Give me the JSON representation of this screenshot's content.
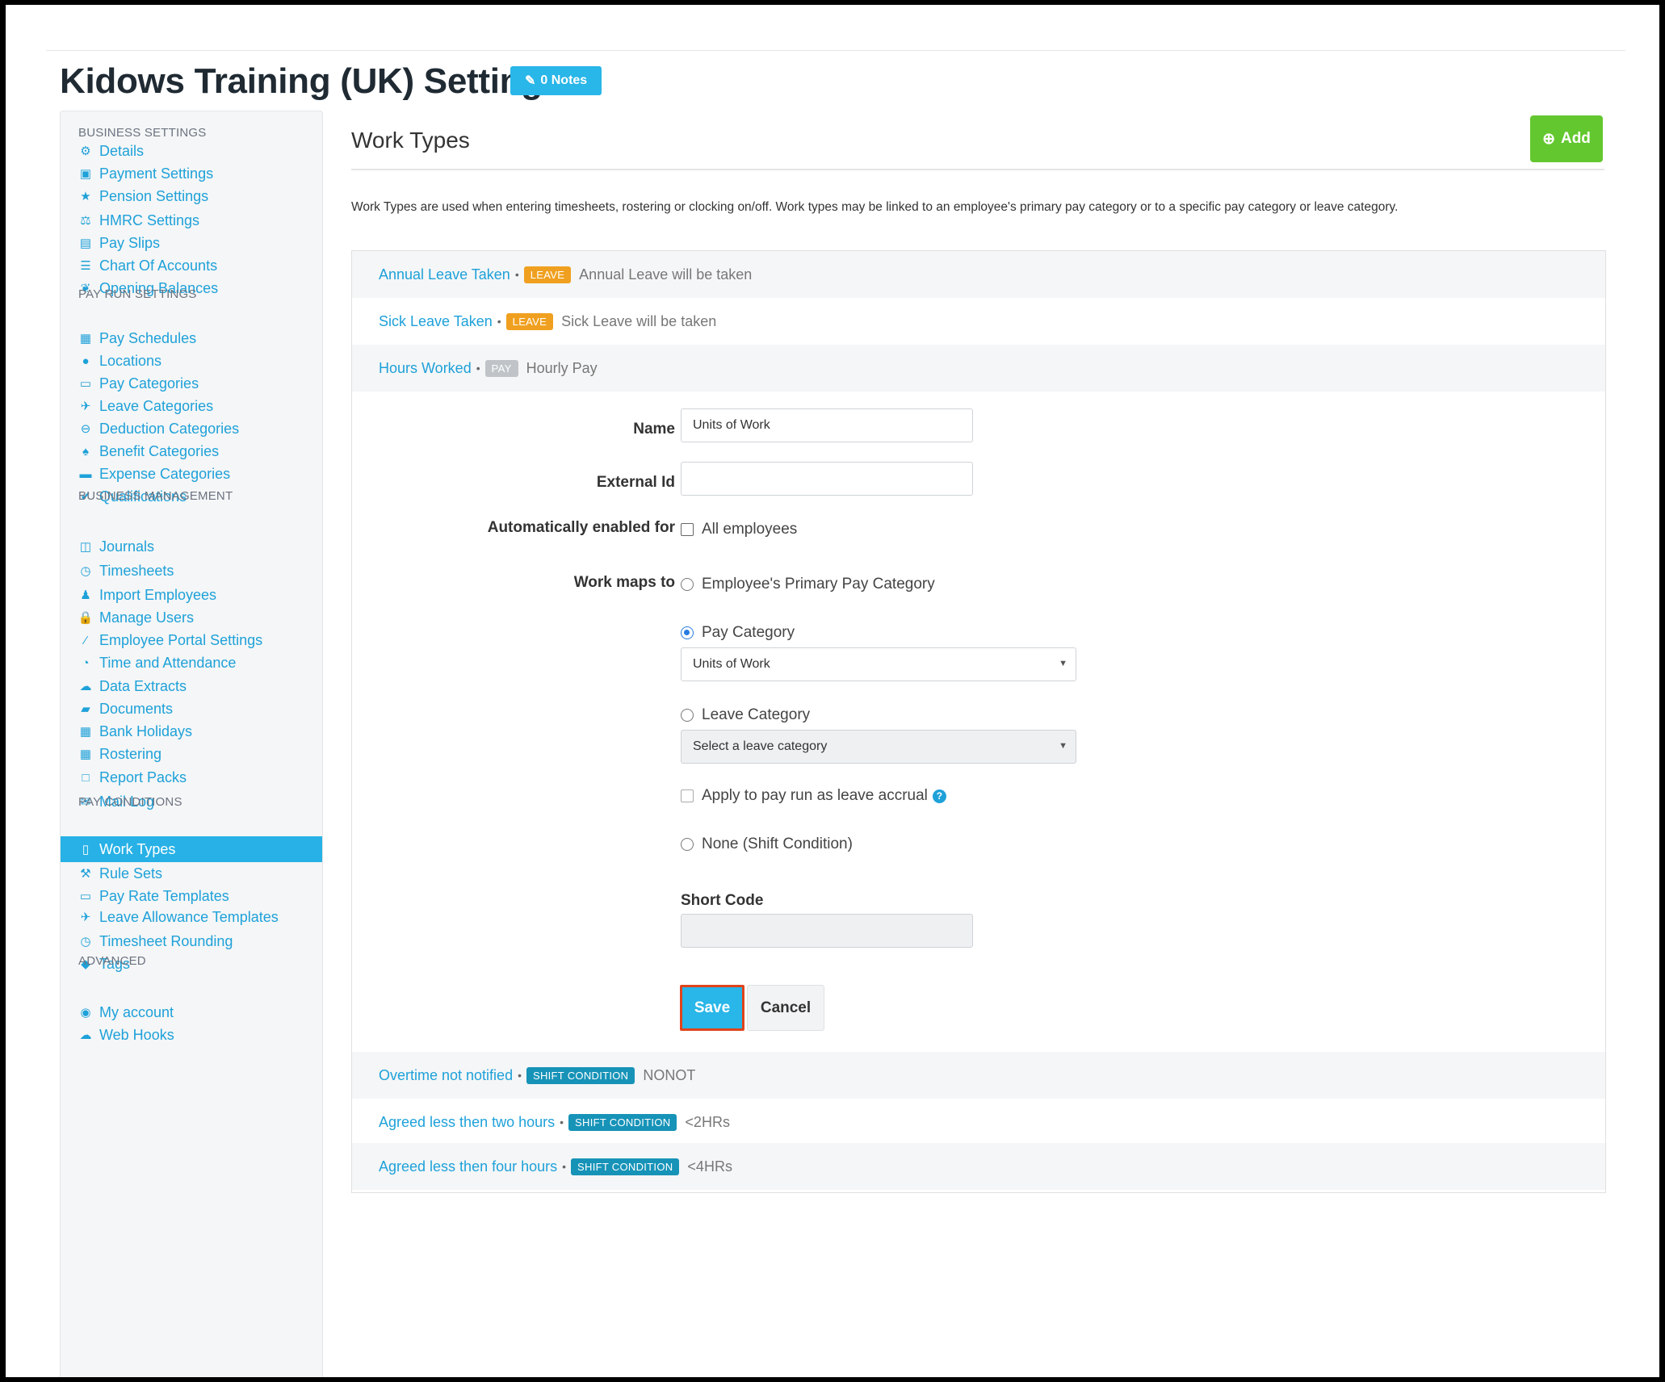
{
  "header": {
    "title": "Kidows Training (UK) Settings",
    "notes_label": "0 Notes"
  },
  "sidebar": {
    "sections": [
      {
        "title": "BUSINESS SETTINGS",
        "items": [
          {
            "label": "Details",
            "icon": "gear-icon"
          },
          {
            "label": "Payment Settings",
            "icon": "floppy-icon"
          },
          {
            "label": "Pension Settings",
            "icon": "star-icon"
          },
          {
            "label": "HMRC Settings",
            "icon": "scales-icon"
          },
          {
            "label": "Pay Slips",
            "icon": "file-icon"
          },
          {
            "label": "Chart Of Accounts",
            "icon": "list-icon"
          },
          {
            "label": "Opening Balances",
            "icon": "leaf-icon"
          }
        ]
      },
      {
        "title": "PAY RUN SETTINGS",
        "items": [
          {
            "label": "Pay Schedules",
            "icon": "calendar-icon"
          },
          {
            "label": "Locations",
            "icon": "globe-icon"
          },
          {
            "label": "Pay Categories",
            "icon": "money-icon"
          },
          {
            "label": "Leave Categories",
            "icon": "plane-icon"
          },
          {
            "label": "Deduction Categories",
            "icon": "minus-circle-icon"
          },
          {
            "label": "Benefit Categories",
            "icon": "benefit-icon"
          },
          {
            "label": "Expense Categories",
            "icon": "archive-icon"
          },
          {
            "label": "Qualifications",
            "icon": "check-icon"
          }
        ]
      },
      {
        "title": "BUSINESS MANAGEMENT",
        "items": [
          {
            "label": "Journals",
            "icon": "columns-icon"
          },
          {
            "label": "Timesheets",
            "icon": "clock-icon"
          },
          {
            "label": "Import Employees",
            "icon": "people-icon"
          },
          {
            "label": "Manage Users",
            "icon": "lock-icon"
          },
          {
            "label": "Employee Portal Settings",
            "icon": "wand-icon"
          },
          {
            "label": "Time and Attendance",
            "icon": "user-clock-icon"
          },
          {
            "label": "Data Extracts",
            "icon": "cloud-download-icon"
          },
          {
            "label": "Documents",
            "icon": "folder-icon"
          },
          {
            "label": "Bank Holidays",
            "icon": "calendar-icon"
          },
          {
            "label": "Rostering",
            "icon": "calendar-grid-icon"
          },
          {
            "label": "Report Packs",
            "icon": "folder-open-icon"
          },
          {
            "label": "Mail Log",
            "icon": "envelope-icon"
          }
        ]
      },
      {
        "title": "PAY CONDITIONS",
        "items": [
          {
            "label": "Work Types",
            "icon": "book-icon",
            "active": true
          },
          {
            "label": "Rule Sets",
            "icon": "gavel-icon"
          },
          {
            "label": "Pay Rate Templates",
            "icon": "money-icon"
          },
          {
            "label": "Leave Allowance Templates",
            "icon": "plane-icon"
          },
          {
            "label": "Timesheet Rounding",
            "icon": "clock-outline-icon"
          },
          {
            "label": "Tags",
            "icon": "tag-icon"
          }
        ]
      },
      {
        "title": "ADVANCED",
        "items": [
          {
            "label": "My account",
            "icon": "user-circle-icon"
          },
          {
            "label": "Web Hooks",
            "icon": "cloud-icon"
          }
        ]
      }
    ]
  },
  "main": {
    "title": "Work Types",
    "add_label": "Add",
    "intro": "Work Types are used when entering timesheets, rostering or clocking on/off. Work types may be linked to an employee's primary pay category or to a specific pay category or leave category.",
    "rows_top": [
      {
        "name": "Annual Leave Taken",
        "badge": "LEAVE",
        "kind": "leave",
        "desc": "Annual Leave will be taken"
      },
      {
        "name": "Sick Leave Taken",
        "badge": "LEAVE",
        "kind": "leave",
        "desc": "Sick Leave will be taken"
      },
      {
        "name": "Hours Worked",
        "badge": "PAY",
        "kind": "pay",
        "desc": "Hourly Pay"
      }
    ],
    "rows_bottom": [
      {
        "name": "Overtime not notified",
        "badge": "SHIFT CONDITION",
        "kind": "shift",
        "desc": "NONOT"
      },
      {
        "name": "Agreed less then two hours",
        "badge": "SHIFT CONDITION",
        "kind": "shift",
        "desc": "<2HRs"
      },
      {
        "name": "Agreed less then four hours",
        "badge": "SHIFT CONDITION",
        "kind": "shift",
        "desc": "<4HRs"
      }
    ],
    "form": {
      "name_label": "Name",
      "name_value": "Units of Work",
      "external_id_label": "External Id",
      "external_id_value": "",
      "auto_enabled_label": "Automatically enabled for",
      "all_employees_label": "All employees",
      "work_maps_label": "Work maps to",
      "opt_primary": "Employee's Primary Pay Category",
      "opt_pay_category": "Pay Category",
      "pay_category_value": "Units of Work",
      "opt_leave_category": "Leave Category",
      "leave_category_value": "Select a leave category",
      "apply_accrual_label": "Apply to pay run as leave accrual",
      "opt_none": "None (Shift Condition)",
      "short_code_label": "Short Code",
      "short_code_value": "",
      "save_label": "Save",
      "cancel_label": "Cancel"
    }
  }
}
